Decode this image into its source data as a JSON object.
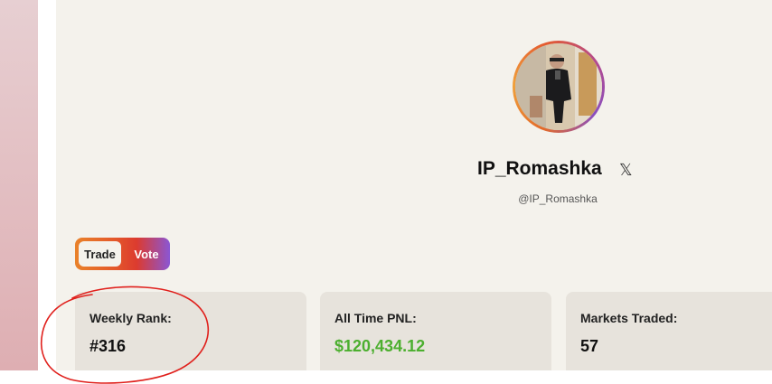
{
  "profile": {
    "name": "IP_Romashka",
    "handle": "@IP_Romashka",
    "social_icon": "x-logo-icon",
    "avatar_description_icon": "user-photo"
  },
  "toggle": {
    "trade_label": "Trade",
    "vote_label": "Vote",
    "selected": "Trade"
  },
  "stats": [
    {
      "label": "Weekly Rank:",
      "value": "#316"
    },
    {
      "label": "All Time PNL:",
      "value": "$120,434.12"
    },
    {
      "label": "Markets Traded:",
      "value": "57"
    }
  ],
  "colors": {
    "background": "#f4f2ec",
    "card": "#e7e3dc",
    "pnl_positive": "#4caf2f",
    "annotation": "#e0201c"
  }
}
